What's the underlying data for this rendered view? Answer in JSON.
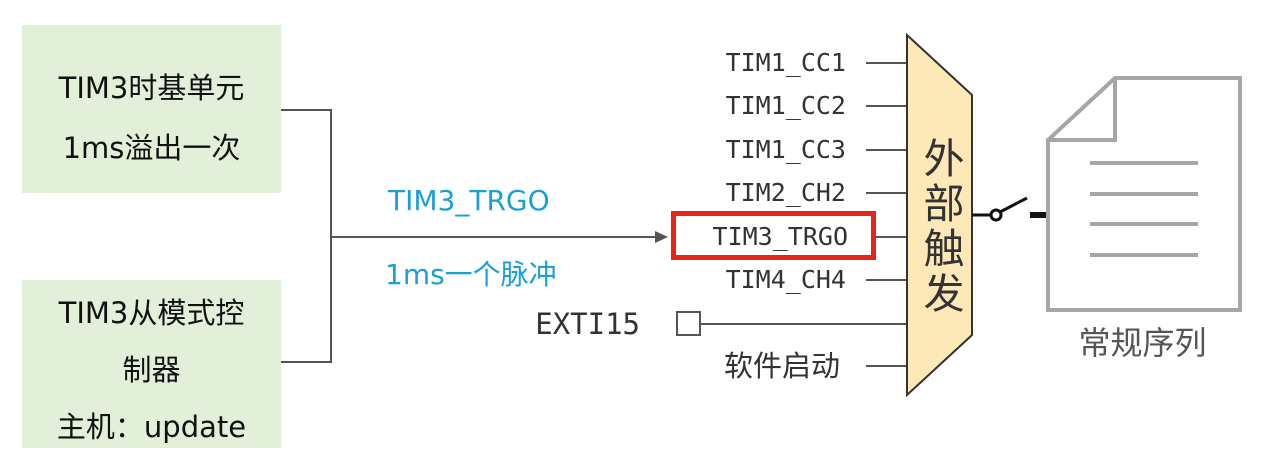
{
  "left_boxes": {
    "timebase": {
      "line1": "TIM3时基单元",
      "line2": "1ms溢出一次"
    },
    "slave_controller": {
      "line1": "TIM3从模式控",
      "line2": "制器",
      "line3": "主机：update"
    }
  },
  "signal": {
    "name": "TIM3_TRGO",
    "description": "1ms一个脉冲"
  },
  "mux": {
    "label": "外部触发",
    "inputs": [
      "TIM1_CC1",
      "TIM1_CC2",
      "TIM1_CC3",
      "TIM2_CH2",
      "TIM3_TRGO",
      "TIM4_CH4",
      "EXTI15",
      "软件启动"
    ],
    "highlighted_input": "TIM3_TRGO"
  },
  "output": {
    "label": "常规序列",
    "icon": "document-icon"
  },
  "colors": {
    "box_fill": "#e2f0d9",
    "signal_text": "#1a9fd9",
    "highlight_border": "#e8231a",
    "mux_fill": "#fde9b8",
    "doc_stroke": "#a6a6a6"
  }
}
